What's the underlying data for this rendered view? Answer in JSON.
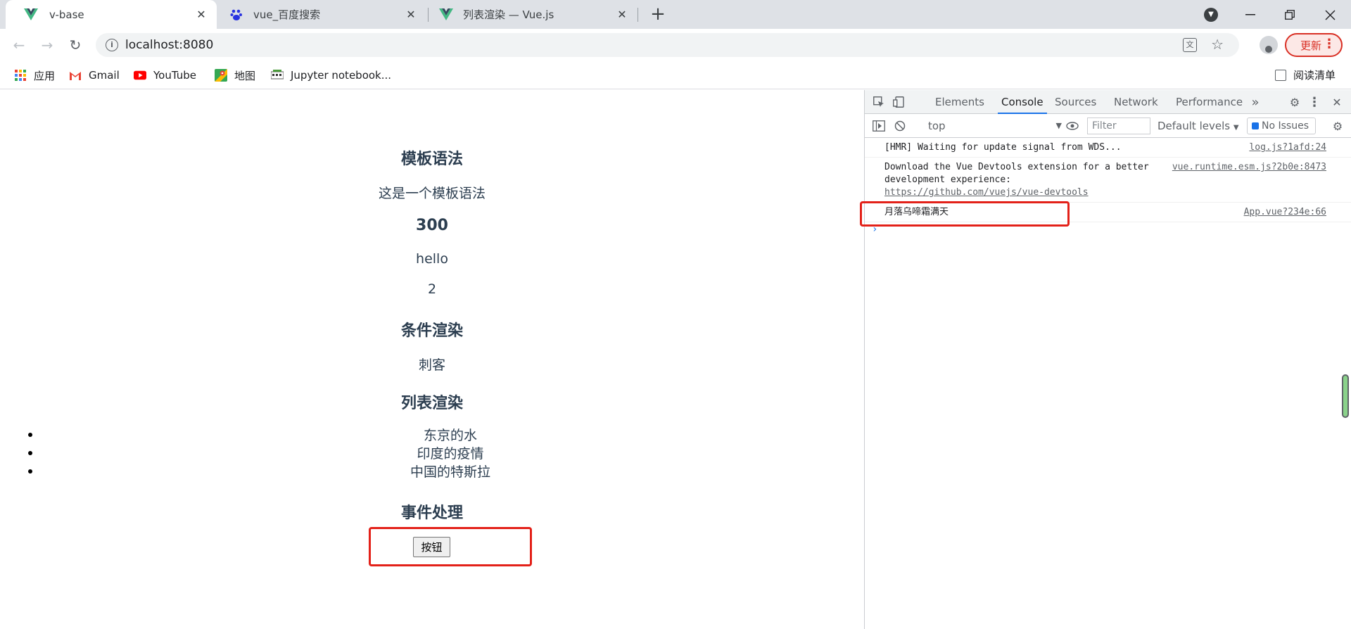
{
  "browser": {
    "tabs": [
      {
        "title": "v-base",
        "icon": "vue-logo-icon",
        "active": true
      },
      {
        "title": "vue_百度搜索",
        "icon": "baidu-paw-icon",
        "active": false
      },
      {
        "title": "列表渲染 — Vue.js",
        "icon": "vue-logo-icon",
        "active": false
      }
    ],
    "url": "localhost:8080",
    "update_label": "更新",
    "bookmarks": [
      {
        "label": "应用",
        "icon": "apps-grid-icon"
      },
      {
        "label": "Gmail",
        "icon": "gmail-icon"
      },
      {
        "label": "YouTube",
        "icon": "youtube-icon"
      },
      {
        "label": "地图",
        "icon": "maps-icon"
      },
      {
        "label": "Jupyter notebook...",
        "icon": "jupyter-icon"
      }
    ],
    "reading_list": "阅读清单"
  },
  "page": {
    "template_heading": "模板语法",
    "template_text": "这是一个模板语法",
    "number": "300",
    "hello": "hello",
    "count": "2",
    "condition_heading": "条件渲染",
    "condition_text": "刺客",
    "list_heading": "列表渲染",
    "list_items": [
      "东京的水",
      "印度的疫情",
      "中国的特斯拉"
    ],
    "event_heading": "事件处理",
    "button_label": "按钮"
  },
  "devtools": {
    "tabs": [
      "Elements",
      "Console",
      "Sources",
      "Network",
      "Performance"
    ],
    "active_tab": "Console",
    "context": "top",
    "filter_placeholder": "Filter",
    "levels": "Default levels",
    "issues": "No Issues",
    "messages": [
      {
        "text": "[HMR] Waiting for update signal from WDS...",
        "source": "log.js?1afd:24"
      },
      {
        "text": "Download the Vue Devtools extension for a better development experience:",
        "link": "https://github.com/vuejs/vue-devtools",
        "source": "vue.runtime.esm.js?2b0e:8473"
      },
      {
        "text": "月落乌啼霜满天",
        "source": "App.vue?234e:66"
      }
    ]
  },
  "colors": {
    "highlight_box": "#e32119",
    "vue_green": "#42b883",
    "vue_dark": "#35495e",
    "page_text": "#2c3e50",
    "active_tab_underline": "#1a73e8"
  }
}
